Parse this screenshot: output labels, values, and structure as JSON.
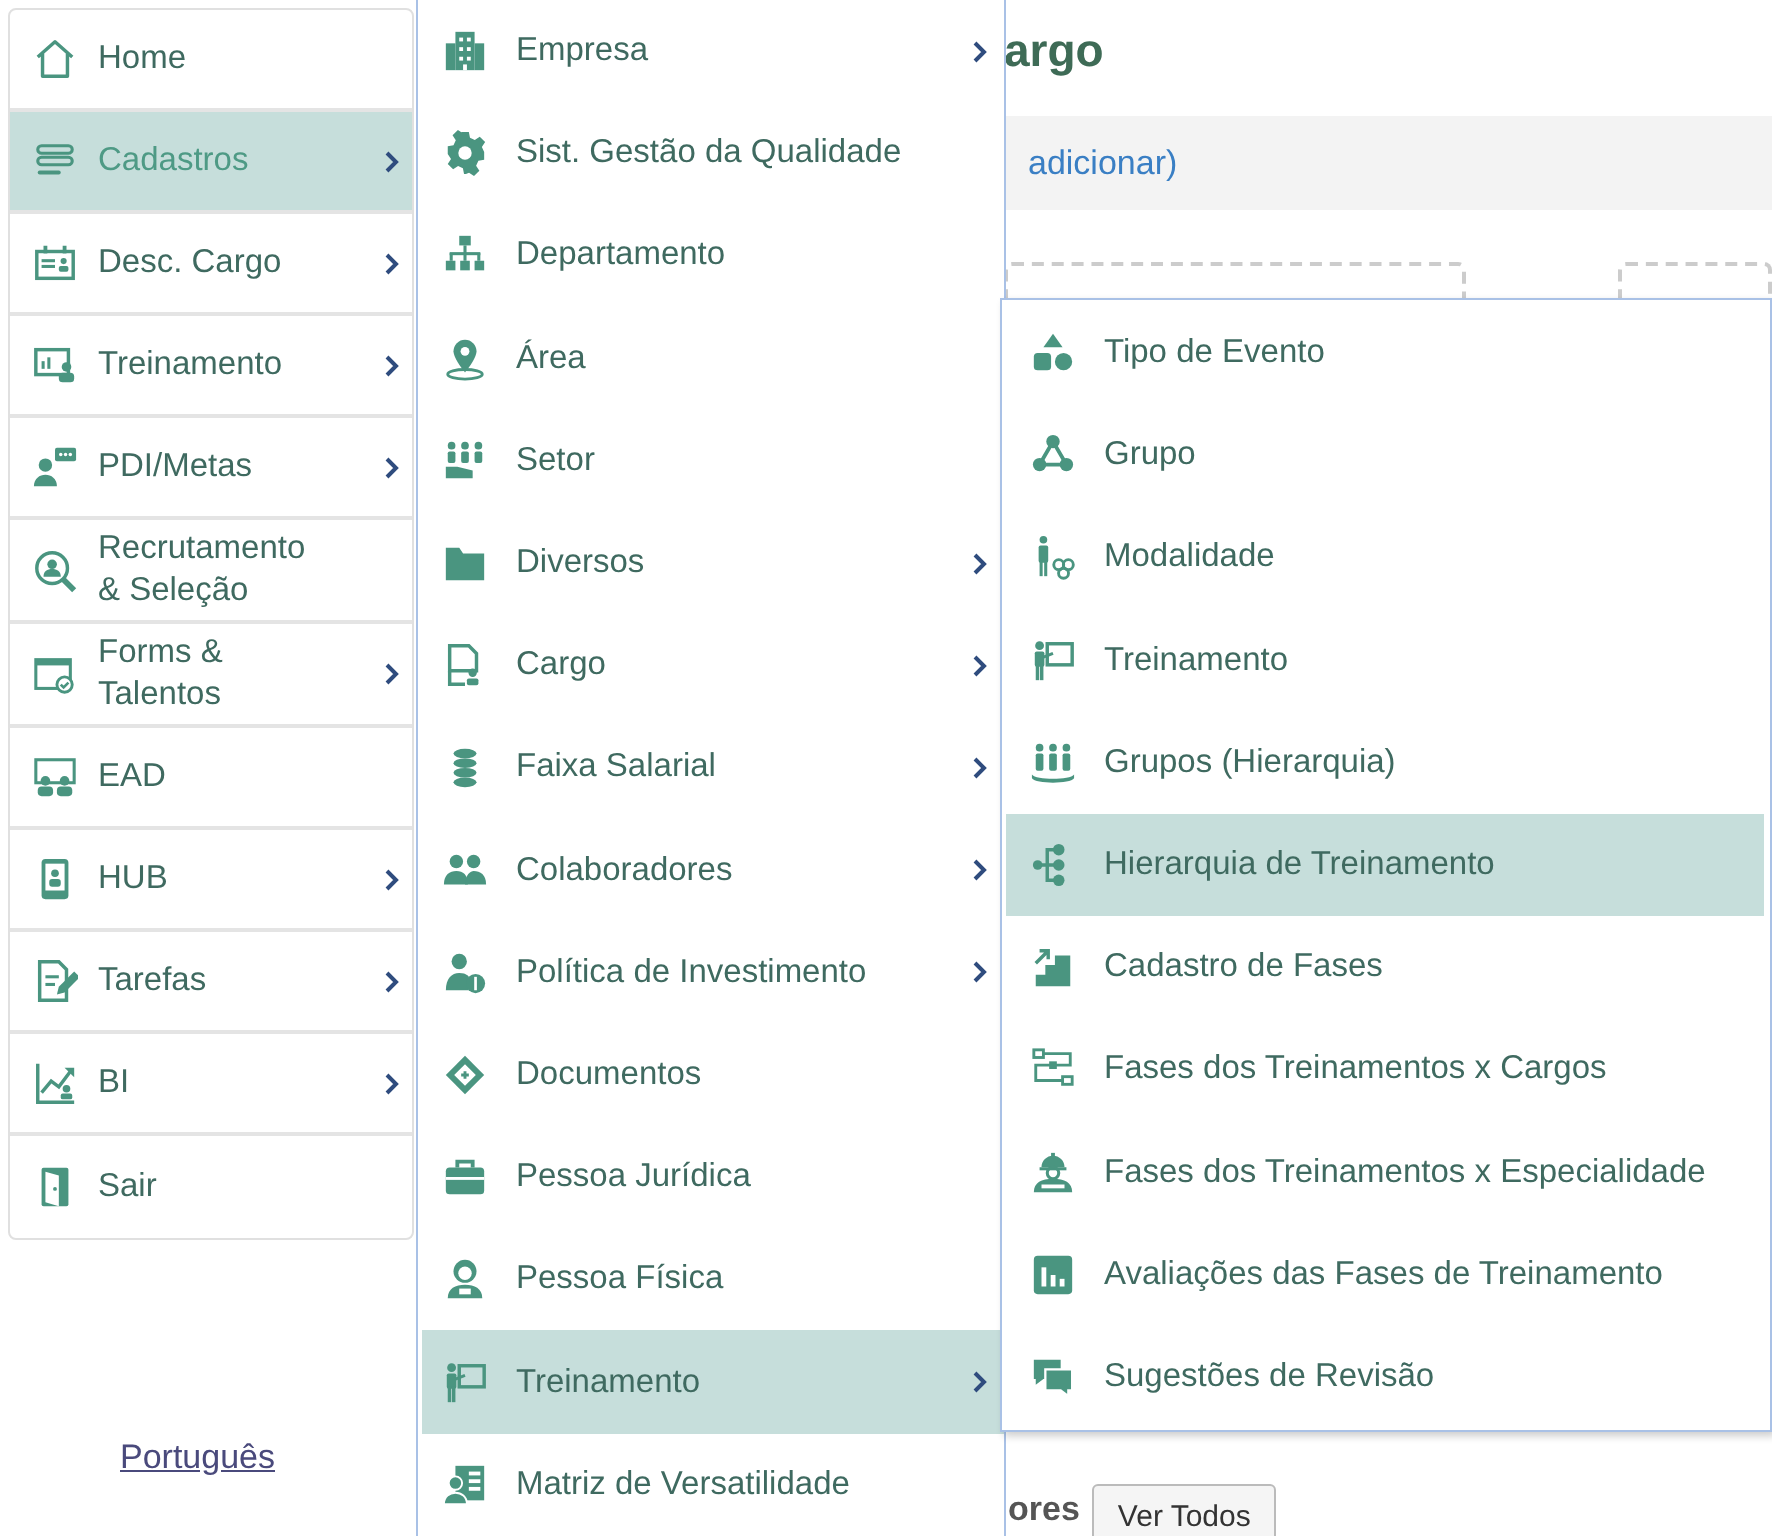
{
  "page": {
    "title": "argo",
    "add_link": "adicionar)",
    "section_label": "ores",
    "view_all_button": "Ver Todos"
  },
  "sidebar": {
    "items": [
      {
        "label": "Home",
        "submenu": false,
        "selected": false
      },
      {
        "label": "Cadastros",
        "submenu": true,
        "selected": true
      },
      {
        "label": "Desc. Cargo",
        "submenu": true,
        "selected": false
      },
      {
        "label": "Treinamento",
        "submenu": true,
        "selected": false
      },
      {
        "label": "PDI/Metas",
        "submenu": true,
        "selected": false
      },
      {
        "label": "Recrutamento & Seleção",
        "submenu": false,
        "selected": false
      },
      {
        "label": "Forms & Talentos",
        "submenu": true,
        "selected": false
      },
      {
        "label": "EAD",
        "submenu": false,
        "selected": false
      },
      {
        "label": "HUB",
        "submenu": true,
        "selected": false
      },
      {
        "label": "Tarefas",
        "submenu": true,
        "selected": false
      },
      {
        "label": "BI",
        "submenu": true,
        "selected": false
      },
      {
        "label": "Sair",
        "submenu": false,
        "selected": false
      }
    ],
    "language_link": "Português"
  },
  "submenu": {
    "items": [
      {
        "label": "Empresa",
        "submenu": true,
        "selected": false
      },
      {
        "label": "Sist. Gestão da Qualidade",
        "submenu": false,
        "selected": false
      },
      {
        "label": "Departamento",
        "submenu": false,
        "selected": false
      },
      {
        "label": "Área",
        "submenu": false,
        "selected": false
      },
      {
        "label": "Setor",
        "submenu": false,
        "selected": false
      },
      {
        "label": "Diversos",
        "submenu": true,
        "selected": false
      },
      {
        "label": "Cargo",
        "submenu": true,
        "selected": false
      },
      {
        "label": "Faixa Salarial",
        "submenu": true,
        "selected": false
      },
      {
        "label": "Colaboradores",
        "submenu": true,
        "selected": false
      },
      {
        "label": "Política de Investimento",
        "submenu": true,
        "selected": false
      },
      {
        "label": "Documentos",
        "submenu": false,
        "selected": false
      },
      {
        "label": "Pessoa Jurídica",
        "submenu": false,
        "selected": false
      },
      {
        "label": "Pessoa Física",
        "submenu": false,
        "selected": false
      },
      {
        "label": "Treinamento",
        "submenu": true,
        "selected": true
      },
      {
        "label": "Matriz de Versatilidade",
        "submenu": false,
        "selected": false
      }
    ]
  },
  "training_submenu": {
    "items": [
      {
        "label": "Tipo de Evento",
        "selected": false
      },
      {
        "label": "Grupo",
        "selected": false
      },
      {
        "label": "Modalidade",
        "selected": false
      },
      {
        "label": "Treinamento",
        "selected": false
      },
      {
        "label": "Grupos (Hierarquia)",
        "selected": false
      },
      {
        "label": "Hierarquia de Treinamento",
        "selected": true
      },
      {
        "label": "Cadastro de Fases",
        "selected": false
      },
      {
        "label": "Fases dos Treinamentos x Cargos",
        "selected": false
      },
      {
        "label": "Fases dos Treinamentos x Especialidade",
        "selected": false
      },
      {
        "label": "Avaliações das Fases de Treinamento",
        "selected": false
      },
      {
        "label": "Sugestões de Revisão",
        "selected": false
      }
    ]
  }
}
